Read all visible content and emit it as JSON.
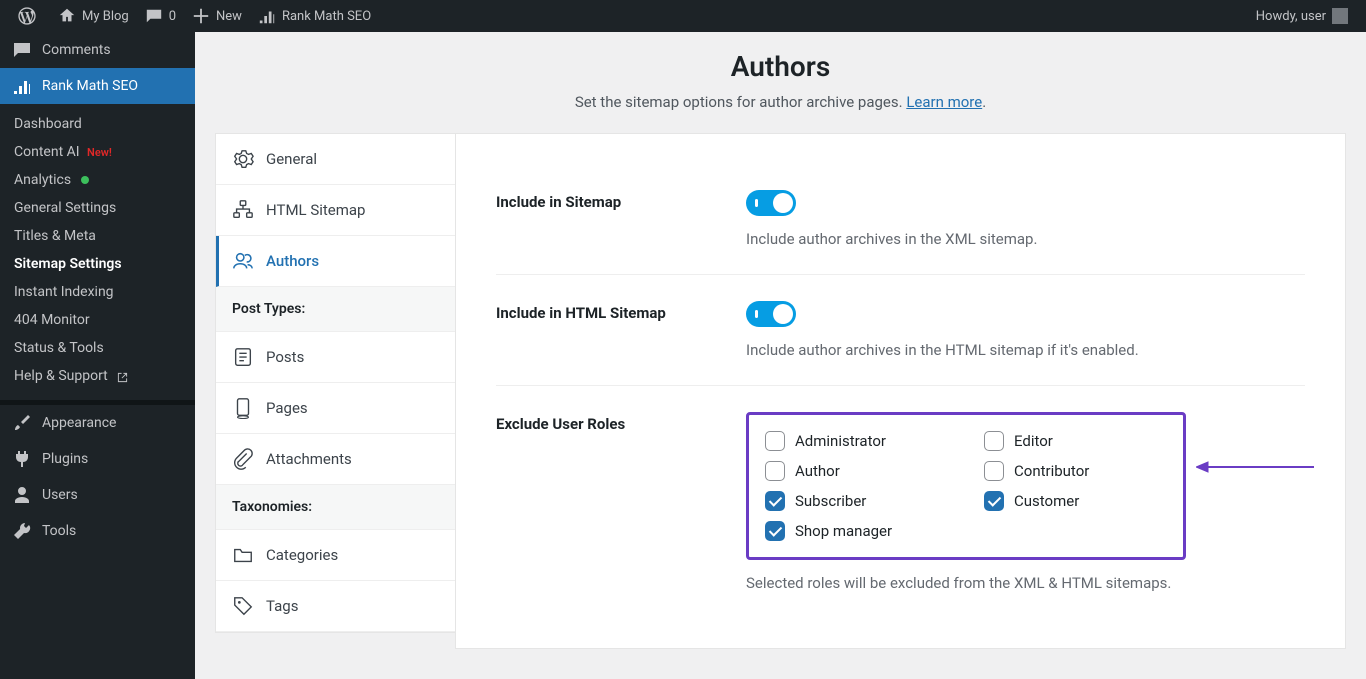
{
  "adminbar": {
    "site_name": "My Blog",
    "comments_count": "0",
    "new_label": "New",
    "rankmath_label": "Rank Math SEO",
    "howdy": "Howdy, user"
  },
  "wp_sidebar": {
    "comments": "Comments",
    "rankmath": "Rank Math SEO",
    "submenu": {
      "dashboard": "Dashboard",
      "content_ai": "Content AI",
      "content_ai_badge": "New!",
      "analytics": "Analytics",
      "general_settings": "General Settings",
      "titles_meta": "Titles & Meta",
      "sitemap_settings": "Sitemap Settings",
      "instant_indexing": "Instant Indexing",
      "monitor_404": "404 Monitor",
      "status_tools": "Status & Tools",
      "help_support": "Help & Support"
    },
    "appearance": "Appearance",
    "plugins": "Plugins",
    "users": "Users",
    "tools": "Tools"
  },
  "page_header": {
    "title": "Authors",
    "subtitle_before": "Set the sitemap options for author archive pages. ",
    "learn_more": "Learn more",
    "subtitle_after": "."
  },
  "tabs": {
    "general": "General",
    "html_sitemap": "HTML Sitemap",
    "authors": "Authors",
    "group_post_types": "Post Types:",
    "posts": "Posts",
    "pages": "Pages",
    "attachments": "Attachments",
    "group_taxonomies": "Taxonomies:",
    "categories": "Categories",
    "tags": "Tags"
  },
  "fields": {
    "include_sitemap": {
      "label": "Include in Sitemap",
      "desc": "Include author archives in the XML sitemap."
    },
    "include_html": {
      "label": "Include in HTML Sitemap",
      "desc": "Include author archives in the HTML sitemap if it's enabled."
    },
    "exclude_roles": {
      "label": "Exclude User Roles",
      "desc": "Selected roles will be excluded from the XML & HTML sitemaps.",
      "roles": [
        {
          "name": "Administrator",
          "checked": false
        },
        {
          "name": "Editor",
          "checked": false
        },
        {
          "name": "Author",
          "checked": false
        },
        {
          "name": "Contributor",
          "checked": false
        },
        {
          "name": "Subscriber",
          "checked": true
        },
        {
          "name": "Customer",
          "checked": true
        },
        {
          "name": "Shop manager",
          "checked": true
        }
      ]
    }
  }
}
